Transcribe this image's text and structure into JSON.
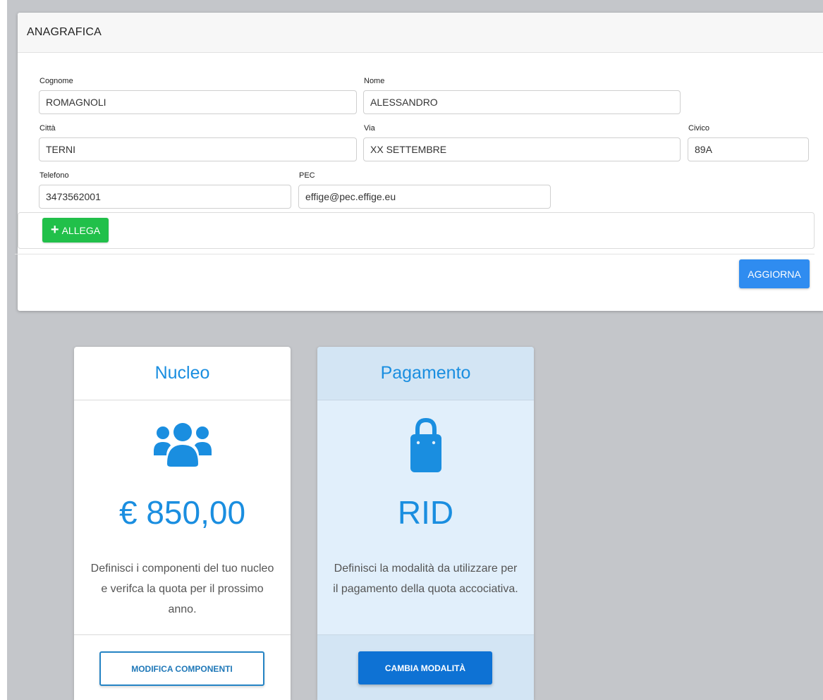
{
  "panel": {
    "title": "ANAGRAFICA",
    "fields": {
      "cognome": {
        "label": "Cognome",
        "value": "ROMAGNOLI"
      },
      "nome": {
        "label": "Nome",
        "value": "ALESSANDRO"
      },
      "citta": {
        "label": "Città",
        "value": "TERNI"
      },
      "via": {
        "label": "Via",
        "value": "XX SETTEMBRE"
      },
      "civico": {
        "label": "Civico",
        "value": "89A"
      },
      "telefono": {
        "label": "Telefono",
        "value": "3473562001"
      },
      "pec": {
        "label": "PEC",
        "value": "effige@pec.effige.eu"
      }
    },
    "attach_label": "ALLEGA",
    "attach_icon": "plus-icon",
    "update_label": "AGGIORNA"
  },
  "cards": {
    "nucleo": {
      "title": "Nucleo",
      "icon": "users-icon",
      "value": "€ 850,00",
      "description": "Definisci i componenti del tuo nucleo e verifca la quota per il prossimo anno.",
      "button_label": "MODIFICA COMPONENTI"
    },
    "pagamento": {
      "title": "Pagamento",
      "icon": "shopping-bag-icon",
      "value": "RID",
      "description": "Definisci la modalità da utilizzare per il pagamento della quota accociativa.",
      "button_label": "CAMBIA MODALITÀ"
    }
  },
  "colors": {
    "accent_blue": "#1a8ee0",
    "primary_button": "#2f8cf0",
    "success_button": "#21c04a",
    "page_background": "#c4c6ca",
    "highlight_card": "#e1effb"
  }
}
